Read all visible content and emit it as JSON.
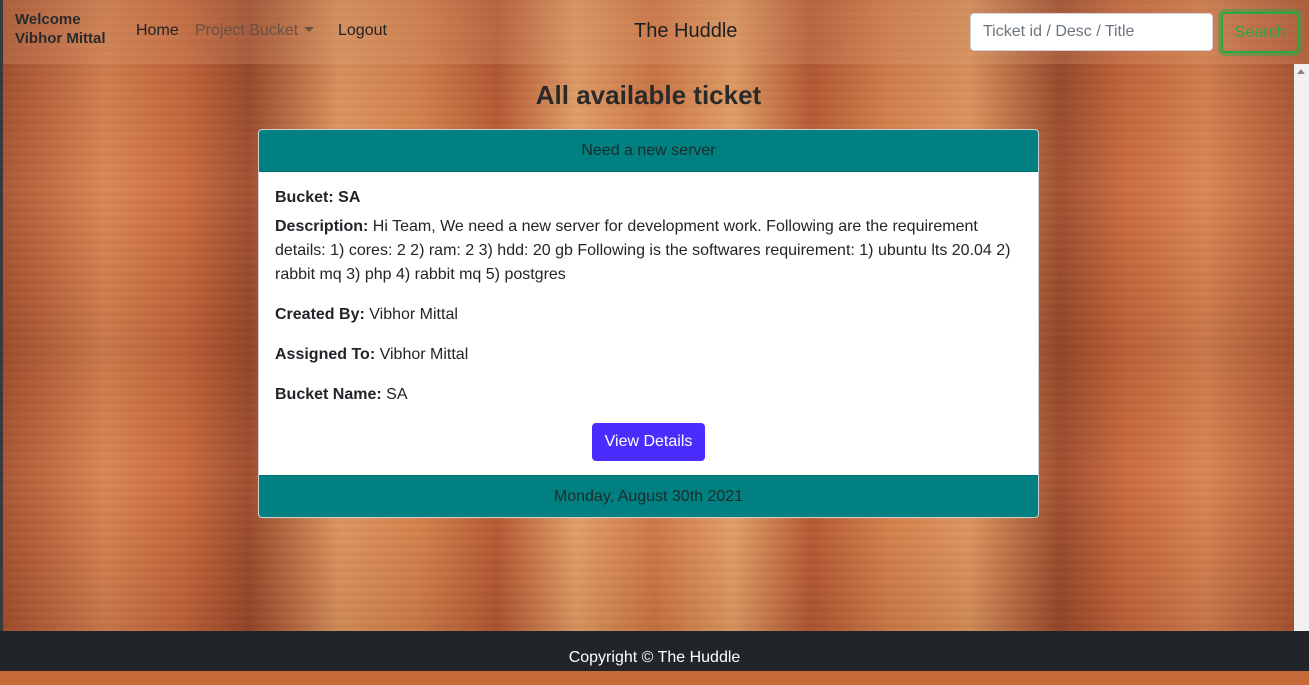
{
  "navbar": {
    "welcome_line1": "Welcome",
    "welcome_line2": "Vibhor Mittal",
    "home": "Home",
    "project_bucket": "Project Bucket",
    "logout": "Logout",
    "site_title": "The Huddle",
    "search_placeholder": "Ticket id / Desc / Title",
    "search_button": "Search"
  },
  "page": {
    "heading": "All available ticket"
  },
  "ticket": {
    "title": "Need a new server",
    "bucket_label": "Bucket:",
    "bucket_value": "SA",
    "description_label": "Description:",
    "description_value": "Hi Team, We need a new server for development work. Following are the requirement details: 1) cores: 2 2) ram: 2 3) hdd: 20 gb Following is the softwares requirement: 1) ubuntu lts 20.04 2) rabbit mq 3) php 4) rabbit mq 5) postgres",
    "created_by_label": "Created By:",
    "created_by_value": "Vibhor Mittal",
    "assigned_to_label": "Assigned To:",
    "assigned_to_value": "Vibhor Mittal",
    "bucket_name_label": "Bucket Name:",
    "bucket_name_value": "SA",
    "view_button": "View Details",
    "date": "Monday, August 30th 2021"
  },
  "footer": {
    "copyright": "Copyright © The Huddle"
  },
  "colors": {
    "card_header": "#008080",
    "view_button": "#4b2cff",
    "search_button": "#28a745",
    "footer": "#212529"
  }
}
